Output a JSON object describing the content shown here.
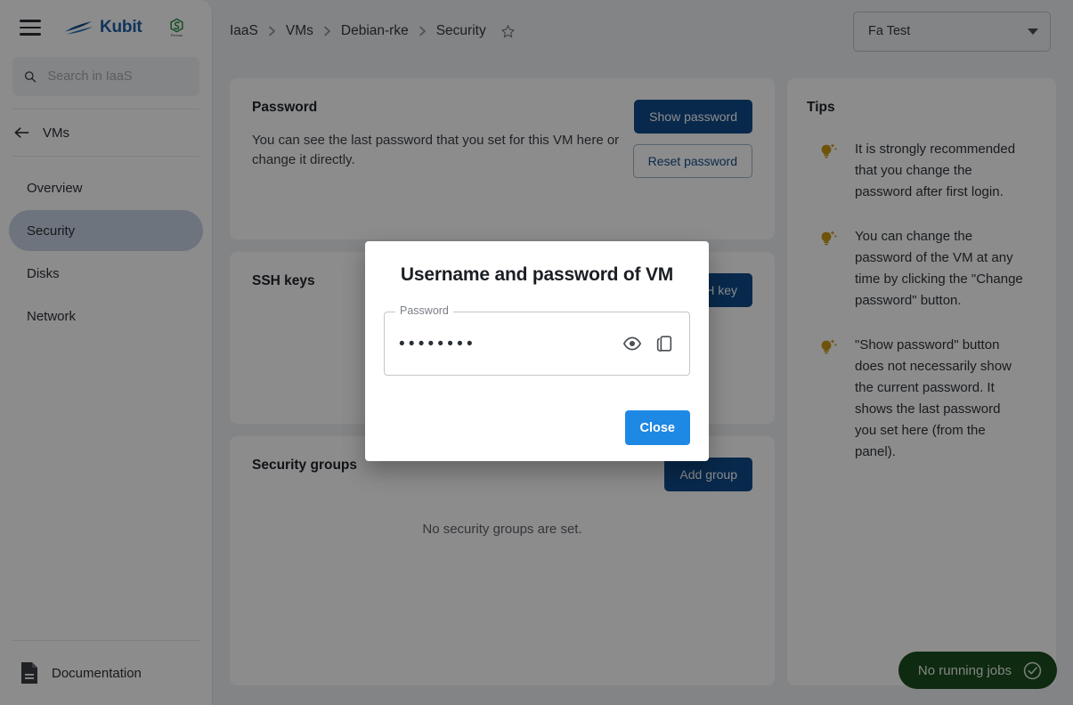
{
  "app": {
    "brand_name": "Kubit",
    "partner_sub": "Persian",
    "logo_color": "#1f5fa8",
    "accent_primary": "#0f4c8a",
    "accent_dialog": "#1e88e5",
    "job_pill_color": "#1b4d1e",
    "tip_bulb_color": "#c99a14"
  },
  "search": {
    "placeholder": "Search in IaaS",
    "value": ""
  },
  "sidebar": {
    "back_label": "VMs",
    "items": [
      {
        "label": "Overview",
        "active": false
      },
      {
        "label": "Security",
        "active": true
      },
      {
        "label": "Disks",
        "active": false
      },
      {
        "label": "Network",
        "active": false
      }
    ],
    "documentation_label": "Documentation"
  },
  "topbar": {
    "breadcrumbs": [
      {
        "label": "IaaS"
      },
      {
        "label": "VMs"
      },
      {
        "label": "Debian-rke"
      },
      {
        "label": "Security"
      }
    ],
    "account_selected": "Fa Test"
  },
  "main": {
    "password_card": {
      "title": "Password",
      "description": "You can see the last password that you set for this VM here or change it directly.",
      "show_button": "Show password",
      "reset_button": "Reset password"
    },
    "ssh_card": {
      "title": "SSH keys",
      "add_button": "Add SSH key"
    },
    "groups_card": {
      "title": "Security groups",
      "add_button": "Add group",
      "empty_message": "No security groups are set."
    }
  },
  "tips": {
    "title": "Tips",
    "items": [
      "It is strongly recommended that you change the password after first login.",
      "You can change the password of the VM at any time by clicking the \"Change password\" button.",
      "\"Show password\" button does not necessarily show the current password. It shows the last password you set here (from the panel)."
    ]
  },
  "status": {
    "jobs_label": "No running jobs"
  },
  "modal": {
    "title": "Username and password of VM",
    "field_label": "Password",
    "field_value": "••••••••",
    "close_button": "Close"
  }
}
